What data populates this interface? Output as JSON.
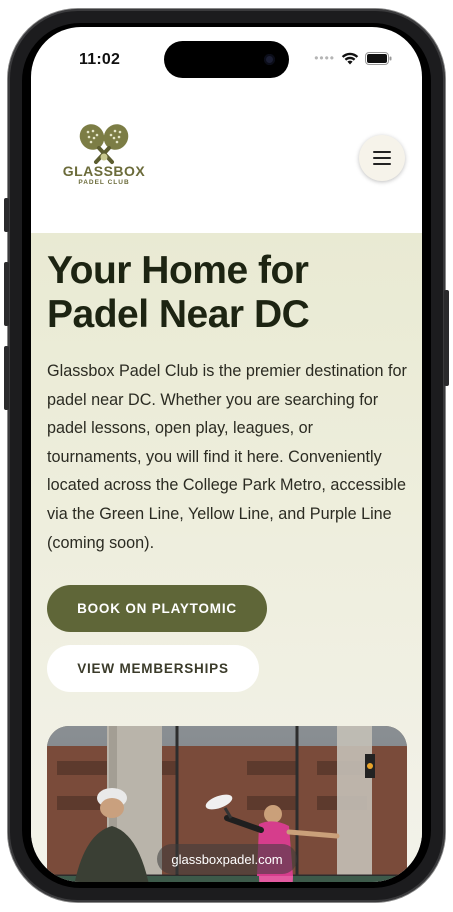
{
  "status_bar": {
    "time": "11:02"
  },
  "header": {
    "logo_name": "GLASSBOX",
    "logo_sub": "PADEL CLUB",
    "menu_icon": "hamburger-menu-icon"
  },
  "hero": {
    "title": "Your Home for Padel Near DC",
    "body": "Glassbox Padel Club is the premier destination for padel near DC. Whether you are searching for padel lessons, open play, leagues, or tournaments, you will find it here. Conveniently located across the College Park Metro, accessible via the Green Line, Yellow Line, and Purple Line (coming soon).",
    "primary_button": "BOOK ON PLAYTOMIC",
    "secondary_button": "VIEW MEMBERSHIPS"
  },
  "browser": {
    "url": "glassboxpadel.com"
  },
  "colors": {
    "accent": "#5f6638",
    "logo": "#6b6b3a",
    "hero_bg": "#ebecd6",
    "title": "#1d2412"
  }
}
